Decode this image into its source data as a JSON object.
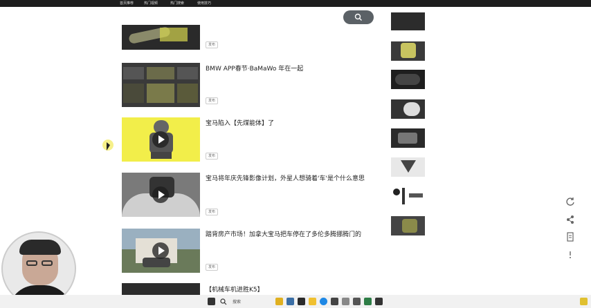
{
  "topnav": {
    "items": [
      "首页推荐",
      "热门视频",
      "热门搜索",
      "使用技巧"
    ]
  },
  "search": {
    "placeholder": ""
  },
  "feed": [
    {
      "title": "",
      "subtitle": "",
      "chip": "发布",
      "meta": "",
      "count": ""
    },
    {
      "title": "BMW APP春节·BaMaWo 年在一起",
      "subtitle": "",
      "thumb_tag": "",
      "chip": "发布",
      "meta": "",
      "count": ""
    },
    {
      "title": "宝马陷入【先煤能体】了",
      "subtitle": "",
      "thumb_tag": "",
      "chip": "发布",
      "meta": "",
      "count": ""
    },
    {
      "title": "宝马将年庆先锋影像计划，外星人想骑着'车'是个什么意思",
      "subtitle": "",
      "thumb_tag": "",
      "chip": "发布",
      "meta": "",
      "count": ""
    },
    {
      "title": "踏背房产市场！加拿大宝马把车停在了多伦多腾挪腾门的",
      "subtitle": "",
      "thumb_tag": "",
      "chip": "发布",
      "meta": "",
      "count": ""
    },
    {
      "title": "【机械车机进胜K5】"
    }
  ],
  "sidebar": [
    {
      "title": "",
      "sub": ""
    },
    {
      "title": "",
      "sub": ""
    },
    {
      "title": "",
      "sub": ""
    },
    {
      "title": "",
      "sub": ""
    },
    {
      "title": "",
      "sub": ""
    },
    {
      "title": "",
      "sub": ""
    },
    {
      "title": "",
      "sub": ""
    },
    {
      "title": "",
      "sub": ""
    }
  ],
  "rail": {
    "icons": [
      "refresh-icon",
      "share-icon",
      "report-icon",
      "more-icon"
    ]
  },
  "taskbar": {
    "search_placeholder": "搜索",
    "time": "",
    "date": ""
  },
  "colors": {
    "accent": "#5b6166",
    "thumb_yellow": "#f2ee4a",
    "nav_bg": "#1e1e1e"
  }
}
